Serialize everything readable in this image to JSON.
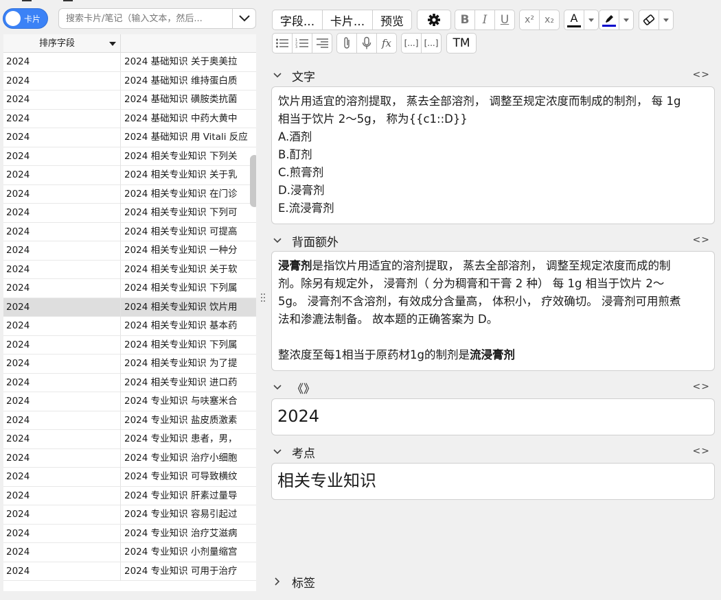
{
  "browser": {
    "toggle_label": "卡片",
    "search_placeholder": "搜索卡片/笔记（输入文本，然后...",
    "columns": [
      "排序字段",
      ""
    ],
    "rows": [
      [
        "2024",
        "2024 基础知识 关于奥美拉"
      ],
      [
        "2024",
        "2024 基础知识 维持蛋白质"
      ],
      [
        "2024",
        "2024 基础知识 磺胺类抗菌"
      ],
      [
        "2024",
        "2024 基础知识 中药大黄中"
      ],
      [
        "2024",
        "2024 基础知识 用 Vitali 反应"
      ],
      [
        "2024",
        "2024 相关专业知识 下列关"
      ],
      [
        "2024",
        "2024 相关专业知识 关于乳"
      ],
      [
        "2024",
        "2024 相关专业知识 在门诊"
      ],
      [
        "2024",
        "2024 相关专业知识 下列可"
      ],
      [
        "2024",
        "2024 相关专业知识 可提高"
      ],
      [
        "2024",
        "2024 相关专业知识 一种分"
      ],
      [
        "2024",
        "2024 相关专业知识 关于软"
      ],
      [
        "2024",
        "2024 相关专业知识 下列属"
      ],
      [
        "2024",
        "2024 相关专业知识 饮片用"
      ],
      [
        "2024",
        "2024 相关专业知识 基本药"
      ],
      [
        "2024",
        "2024 相关专业知识 下列属"
      ],
      [
        "2024",
        "2024 相关专业知识 为了提"
      ],
      [
        "2024",
        "2024 相关专业知识 进口药"
      ],
      [
        "2024",
        "2024 专业知识 与呋塞米合"
      ],
      [
        "2024",
        "2024 专业知识 盐皮质激素"
      ],
      [
        "2024",
        "2024 专业知识 患者，男，"
      ],
      [
        "2024",
        "2024 专业知识 治疗小细胞"
      ],
      [
        "2024",
        "2024 专业知识 可导致横纹"
      ],
      [
        "2024",
        "2024 专业知识 肝素过量导"
      ],
      [
        "2024",
        "2024 专业知识 容易引起过"
      ],
      [
        "2024",
        "2024 专业知识 治疗艾滋病"
      ],
      [
        "2024",
        "2024 专业知识 小剂量缩宫"
      ],
      [
        "2024",
        "2024 专业知识 可用于治疗"
      ]
    ],
    "selected_row": 13
  },
  "toolbar": {
    "fields_btn": "字段...",
    "cards_btn": "卡片...",
    "preview_btn": "预览",
    "bold": "B",
    "italic": "I",
    "underline": "U",
    "superscript": "x²",
    "subscript": "x₂",
    "text_color_letter": "A",
    "cloze_label": "[...]",
    "cloze_same_label": "[...]",
    "tm_label": "TM",
    "fx_label": "fx",
    "text_color": "#000000",
    "highlight_color": "#0000cc"
  },
  "fields": {
    "text": {
      "name": "文字",
      "lines": [
        "饮片用适宜的溶剂提取，  蒸去全部溶剂，  调整至规定浓度而制成的制剂，  每 1g",
        "相当于饮片 2～5g，  称为{{c1::D}}",
        "A.酒剂",
        "B.酊剂",
        "C.煎膏剂",
        "D.浸膏剂",
        "E.流浸膏剂"
      ]
    },
    "back_extra": {
      "name": "背面额外",
      "bold1": "浸膏剂",
      "line1": "是指饮片用适宜的溶剂提取，  蒸去全部溶剂，  调整至规定浓度而成的制",
      "line2": "剂。除另有规定外，  浸膏剂（ 分为稠膏和干膏 2 种）  每 1g 相当于饮片 2～",
      "line3": "5g。 浸膏剂不含溶剂，有效成分含量高，  体积小，  疗效确切。 浸膏剂可用煎煮",
      "line4": "法和渗漉法制备。 故本题的正确答案为 D。",
      "line5_pre": "整浓度至每1相当于原药材1g的制剂是",
      "line5_bold": "流浸膏剂"
    },
    "source": {
      "name": "《》",
      "value": "2024"
    },
    "exam_point": {
      "name": "考点",
      "value": "相关专业知识"
    },
    "tags": {
      "name": "标签"
    }
  }
}
